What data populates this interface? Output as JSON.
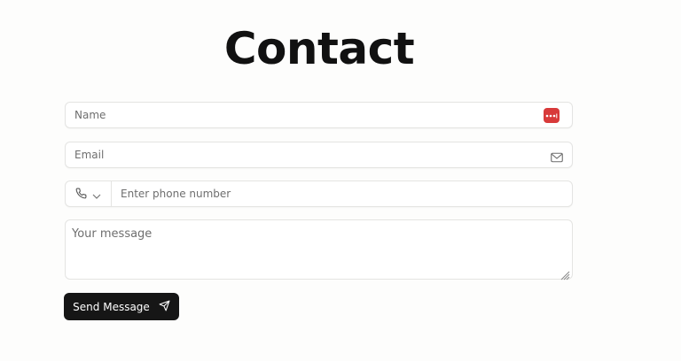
{
  "page": {
    "title": "Contact"
  },
  "form": {
    "name_placeholder": "Name",
    "email_placeholder": "Email",
    "phone_placeholder": "Enter phone number",
    "message_placeholder": "Your message",
    "send_label": "Send Message"
  },
  "icons": {
    "name_field": "password-manager-icon",
    "email_field": "mail-icon",
    "phone_prefix": "phone-icon",
    "phone_dropdown": "chevron-down-icon",
    "send": "send-icon"
  },
  "colors": {
    "button_background": "#161616",
    "password_manager_badge": "#d83a3a",
    "field_border": "#e4e4e2",
    "title_text": "#111111"
  }
}
